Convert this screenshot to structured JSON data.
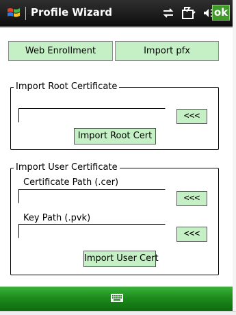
{
  "titlebar": {
    "title": "Profile Wizard",
    "ok_label": "ok",
    "icons": [
      "windows-start-icon",
      "connectivity-icon",
      "battery-icon",
      "volume-icon"
    ]
  },
  "tabs": {
    "web_enrollment": "Web Enrollment",
    "import_pfx": "Import pfx"
  },
  "root_cert": {
    "group_title": "Import Root Certificate",
    "path_value": "",
    "browse_label": "<<<",
    "import_label": "Import Root Cert"
  },
  "user_cert": {
    "group_title": "Import User Certificate",
    "cert_path_label": "Certificate Path (.cer)",
    "cert_path_value": "",
    "cert_browse_label": "<<<",
    "key_path_label": "Key Path (.pvk)",
    "key_path_value": "",
    "key_browse_label": "<<<",
    "import_label": "Import User Cert"
  },
  "menubar": {
    "icons": [
      "keyboard-icon"
    ]
  },
  "colors": {
    "button_bg": "#c5f0c5",
    "menubar_green": "#1d8a1d",
    "ok_green": "#3f9a28",
    "titlebar_bg": "#1a1a1a"
  }
}
